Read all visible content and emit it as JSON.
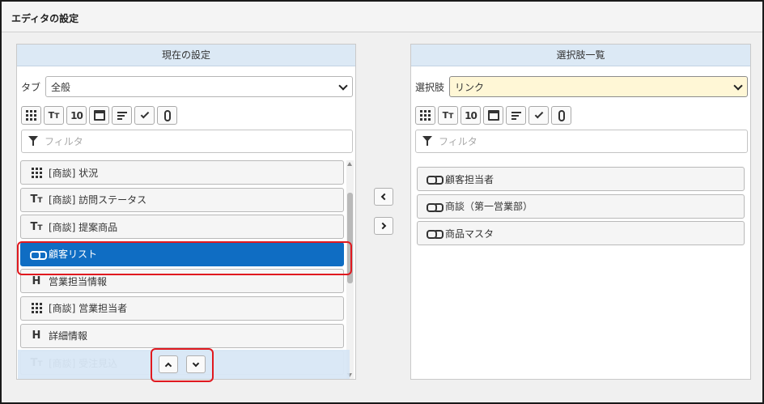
{
  "dialog": {
    "title": "エディタの設定"
  },
  "left_panel": {
    "heading": "現在の設定",
    "select_label": "タブ",
    "select_value": "全般",
    "filter_placeholder": "フィルタ",
    "items": [
      {
        "icon": "grid-dots-icon",
        "label": "[商談] 状況"
      },
      {
        "icon": "text-type-icon",
        "label": "[商談] 訪問ステータス"
      },
      {
        "icon": "text-type-icon",
        "label": "[商談] 提案商品"
      },
      {
        "icon": "link-icon",
        "label": "顧客リスト",
        "selected": true
      },
      {
        "icon": "heading-icon",
        "label": "営業担当情報"
      },
      {
        "icon": "grid-dots-icon",
        "label": "[商談] 営業担当者"
      },
      {
        "icon": "heading-icon",
        "label": "詳細情報"
      },
      {
        "icon": "text-type-icon",
        "label": "[商談] 受注見込"
      }
    ]
  },
  "right_panel": {
    "heading": "選択肢一覧",
    "select_label": "選択肢",
    "select_value": "リンク",
    "filter_placeholder": "フィルタ",
    "items": [
      {
        "icon": "link-icon",
        "label": "顧客担当者"
      },
      {
        "icon": "link-icon",
        "label": "商談（第一営業部）"
      },
      {
        "icon": "link-icon",
        "label": "商品マスタ"
      }
    ]
  },
  "toolbar_icons": [
    "grid-dots-icon",
    "text-type-icon",
    "number-icon",
    "calendar-icon",
    "text-edit-icon",
    "check-icon",
    "paperclip-icon"
  ],
  "toolbar_number_glyph": "10",
  "heading_glyph": "H",
  "colors": {
    "selected": "#0f6dc3",
    "highlight": "#e0191f",
    "panel_header": "#dce9f5",
    "select_yellow": "#fff7d6"
  }
}
